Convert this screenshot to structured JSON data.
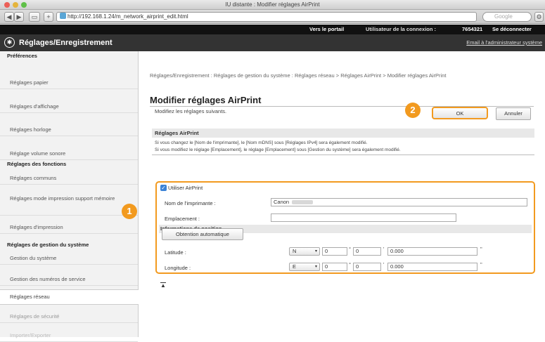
{
  "window": {
    "title": "IU distante : Modifier réglages AirPrint"
  },
  "toolbar": {
    "back": "◀",
    "forward": "▶",
    "bookmarks": "▭",
    "add": "+",
    "url": "http://192.168.1.24/m_network_airprint_edit.html",
    "reload": "↻",
    "search_placeholder": "Google"
  },
  "topstrip": {
    "portal": "Vers le portail",
    "user_label": "Utilisateur de la connexion :",
    "user_value": "7654321",
    "logout": "Se déconnecter"
  },
  "header": {
    "title": "Réglages/Enregistrement",
    "admin_link": "Email à l'administrateur système"
  },
  "sidebar": {
    "sections": [
      {
        "title": "Préférences",
        "items": [
          "Réglages papier",
          "Réglages d'affichage",
          "Réglages horloge",
          "Réglage volume sonore"
        ]
      },
      {
        "title": "Réglages des fonctions",
        "items": [
          "Réglages communs",
          "Réglages mode impression support mémoire",
          "Réglages d'impression"
        ]
      },
      {
        "title": "Réglages de gestion du système",
        "items": [
          "Gestion du système",
          "Gestion des numéros de service",
          "Réglages réseau",
          "Réglages de sécurité",
          "Importer/Exporter"
        ]
      }
    ]
  },
  "main": {
    "breadcrumb": "Réglages/Enregistrement : Réglages de gestion du système : Réglages réseau > Réglages AirPrint > Modifier réglages AirPrint",
    "title": "Modifier réglages AirPrint",
    "instruction": "Modifiez les réglages suivants.",
    "ok_label": "OK",
    "cancel_label": "Annuler",
    "section_title": "Réglages AirPrint",
    "note1": "Si vous changez le [Nom de l'imprimante], le [Nom mDNS] sous [Réglages IPv4] sera également modifié.",
    "note2": "Si vous modifiez le réglage [Emplacement], le réglage [Emplacement] sous [Gestion du système] sera également modifié.",
    "use_airprint": "Utiliser AirPrint",
    "printer_name_label": "Nom de l'imprimante :",
    "printer_name_value": "Canon",
    "location_label": "Emplacement :",
    "location_value": "",
    "position_title": "Informations de position",
    "auto_button": "Obtention automatique",
    "latitude_label": "Latitude :",
    "latitude_dir": "N",
    "latitude_deg": "0",
    "latitude_min": "0",
    "latitude_sec": "0.000",
    "longitude_label": "Longitude :",
    "longitude_dir": "E",
    "longitude_deg": "0",
    "longitude_min": "0",
    "longitude_sec": "0.000",
    "deg_unit": "°",
    "min_unit": "'",
    "sec_unit": "\"",
    "badge1": "1",
    "badge2": "2",
    "top_link": "▲"
  },
  "colors": {
    "accent": "#f29a1f",
    "header_bg": "#333333",
    "topstrip_bg": "#111111"
  }
}
